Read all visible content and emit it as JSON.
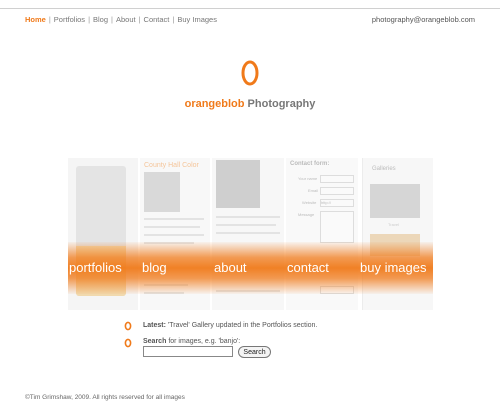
{
  "nav": {
    "items": [
      {
        "label": "Home",
        "active": true
      },
      {
        "label": "Portfolios",
        "active": false
      },
      {
        "label": "Blog",
        "active": false
      },
      {
        "label": "About",
        "active": false
      },
      {
        "label": "Contact",
        "active": false
      },
      {
        "label": "Buy Images",
        "active": false
      }
    ],
    "separator": "|"
  },
  "header": {
    "email": "photography@orangeblob.com",
    "brand_orange": "orangeblob",
    "brand_grey": "Photography"
  },
  "collage": {
    "panel_title": "County Hall Color",
    "form_title": "Contact form:",
    "form_labels": [
      "Your name",
      "Email",
      "Website",
      "Message"
    ],
    "website_placeholder": "http://",
    "gallery_title": "Galleries",
    "gallery_caption": "Travel"
  },
  "banner": {
    "items": [
      "portfolios",
      "blog",
      "about",
      "contact",
      "buy images"
    ]
  },
  "latest": {
    "label": "Latest:",
    "text": "'Travel' Gallery updated in the Portfolios section."
  },
  "search": {
    "label": "Search",
    "hint": "for images, e.g. 'banjo':",
    "value": "",
    "button": "Search"
  },
  "footer": {
    "text": "©Tim Grimshaw, 2009. All rights reserved for all images"
  },
  "colors": {
    "accent": "#f07a1a",
    "text": "#555555"
  }
}
